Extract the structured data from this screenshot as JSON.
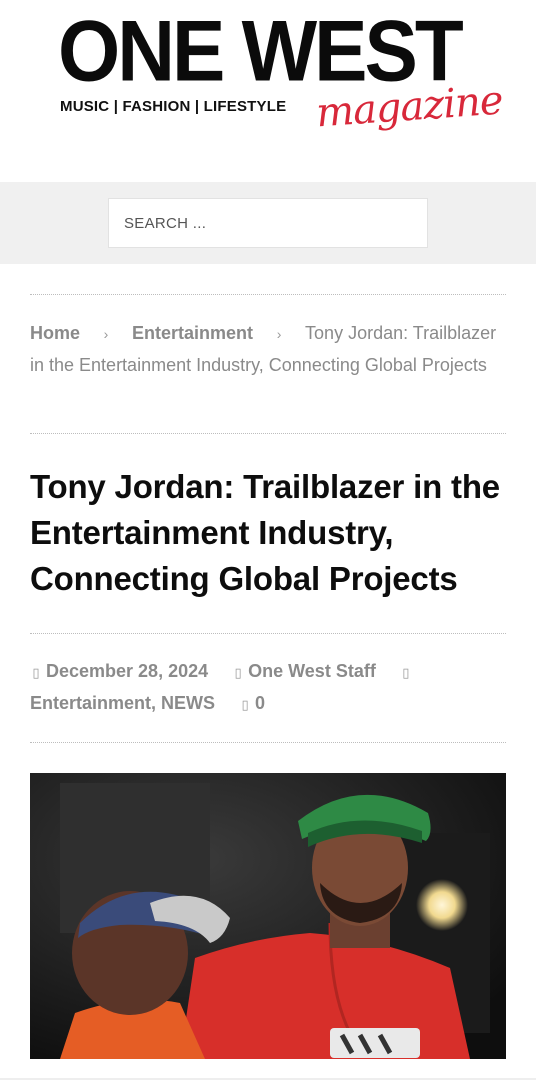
{
  "logo": {
    "brand": "ONE WEST",
    "tagline": "MUSIC | FASHION | LIFESTYLE",
    "script": "magazine"
  },
  "search": {
    "placeholder": "SEARCH ..."
  },
  "breadcrumb": {
    "home": "Home",
    "category": "Entertainment",
    "current": "Tony Jordan: Trailblazer in the Entertainment Industry, Connecting Global Projects",
    "separator_icon": "chevron-right-icon"
  },
  "article": {
    "title": "Tony Jordan: Trailblazer in the Entertainment Industry, Connecting Global Projects",
    "date": "December 28, 2024",
    "author": "One West Staff",
    "categories": "Entertainment, NEWS",
    "comments": "0"
  },
  "icons": {
    "date": "calendar-icon",
    "author": "user-icon",
    "category": "folder-icon",
    "comments": "comment-icon"
  },
  "colors": {
    "accent": "#d8283a",
    "text": "#0d0d0d",
    "muted": "#8a8a8a",
    "search_band": "#f0f0f0"
  }
}
